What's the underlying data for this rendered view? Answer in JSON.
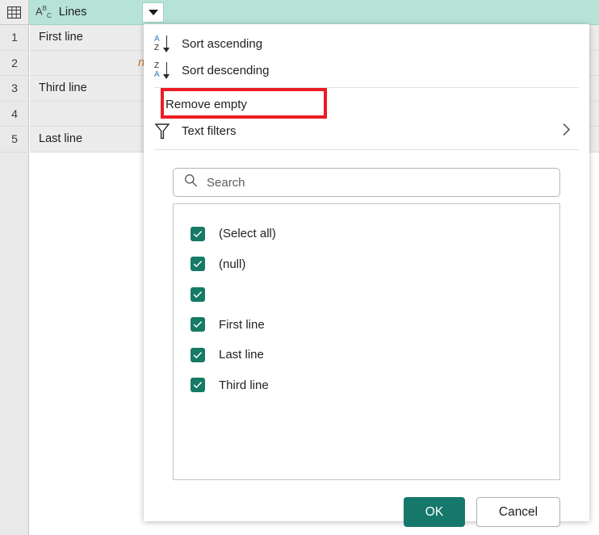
{
  "grid": {
    "corner_icon": "table-grid-icon",
    "column": {
      "type_icon": "abc-text-type-icon",
      "type_icon_text": "ABC",
      "name": "Lines",
      "filter_button_icon": "caret-down-icon"
    },
    "rows": [
      {
        "number": "1",
        "value": "First line"
      },
      {
        "number": "2",
        "value": "",
        "null_marker": "null"
      },
      {
        "number": "3",
        "value": "Third line"
      },
      {
        "number": "4",
        "value": ""
      },
      {
        "number": "5",
        "value": "Last line"
      }
    ]
  },
  "dropdown": {
    "menu": [
      {
        "label": "Sort ascending",
        "icon": "sort-ascending-icon"
      },
      {
        "label": "Sort descending",
        "icon": "sort-descending-icon"
      },
      {
        "label": "Remove empty",
        "icon": "none",
        "highlighted": true
      },
      {
        "label": "Text filters",
        "icon": "funnel-filter-icon",
        "submenu_icon": "chevron-right-icon"
      }
    ],
    "search": {
      "placeholder": "Search",
      "value": "",
      "icon": "search-icon"
    },
    "list": [
      {
        "label": "(Select all)",
        "checked": true
      },
      {
        "label": "(null)",
        "checked": true
      },
      {
        "label": "",
        "checked": true
      },
      {
        "label": "First line",
        "checked": true
      },
      {
        "label": "Last line",
        "checked": true
      },
      {
        "label": "Third line",
        "checked": true
      }
    ],
    "buttons": {
      "ok": "OK",
      "cancel": "Cancel"
    }
  },
  "colors": {
    "header_bg": "#b7e3d7",
    "checkbox_green": "#157a66",
    "ok_button_green": "#15786a",
    "highlight_red": "#ec1c24",
    "null_orange": "#c9742a",
    "sort_letter_blue": "#2b7fc4"
  }
}
